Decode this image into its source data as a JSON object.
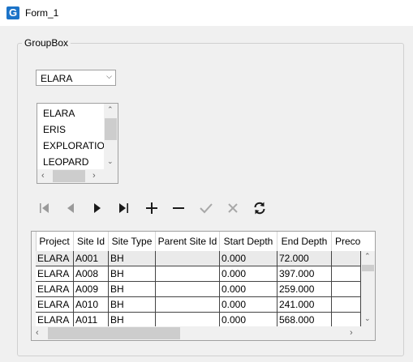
{
  "window": {
    "title": "Form_1",
    "icon_letter": "G"
  },
  "groupbox": {
    "label": "GroupBox"
  },
  "combo": {
    "value": "ELARA"
  },
  "listbox": {
    "items": [
      "ELARA",
      "ERIS",
      "EXPLORATION",
      "LEOPARD"
    ]
  },
  "navigator": {
    "buttons": [
      "first",
      "previous",
      "next",
      "last",
      "add",
      "delete",
      "post",
      "cancel",
      "refresh"
    ]
  },
  "grid": {
    "columns": [
      "Project",
      "Site Id",
      "Site Type",
      "Parent Site Id",
      "Start Depth",
      "End Depth",
      "Precol"
    ],
    "rows": [
      [
        "ELARA",
        "A001",
        "BH",
        "",
        "0.000",
        "72.000",
        ""
      ],
      [
        "ELARA",
        "A008",
        "BH",
        "",
        "0.000",
        "397.000",
        ""
      ],
      [
        "ELARA",
        "A009",
        "BH",
        "",
        "0.000",
        "259.000",
        ""
      ],
      [
        "ELARA",
        "A010",
        "BH",
        "",
        "0.000",
        "241.000",
        ""
      ],
      [
        "ELARA",
        "A011",
        "BH",
        "",
        "0.000",
        "568.000",
        ""
      ]
    ]
  }
}
